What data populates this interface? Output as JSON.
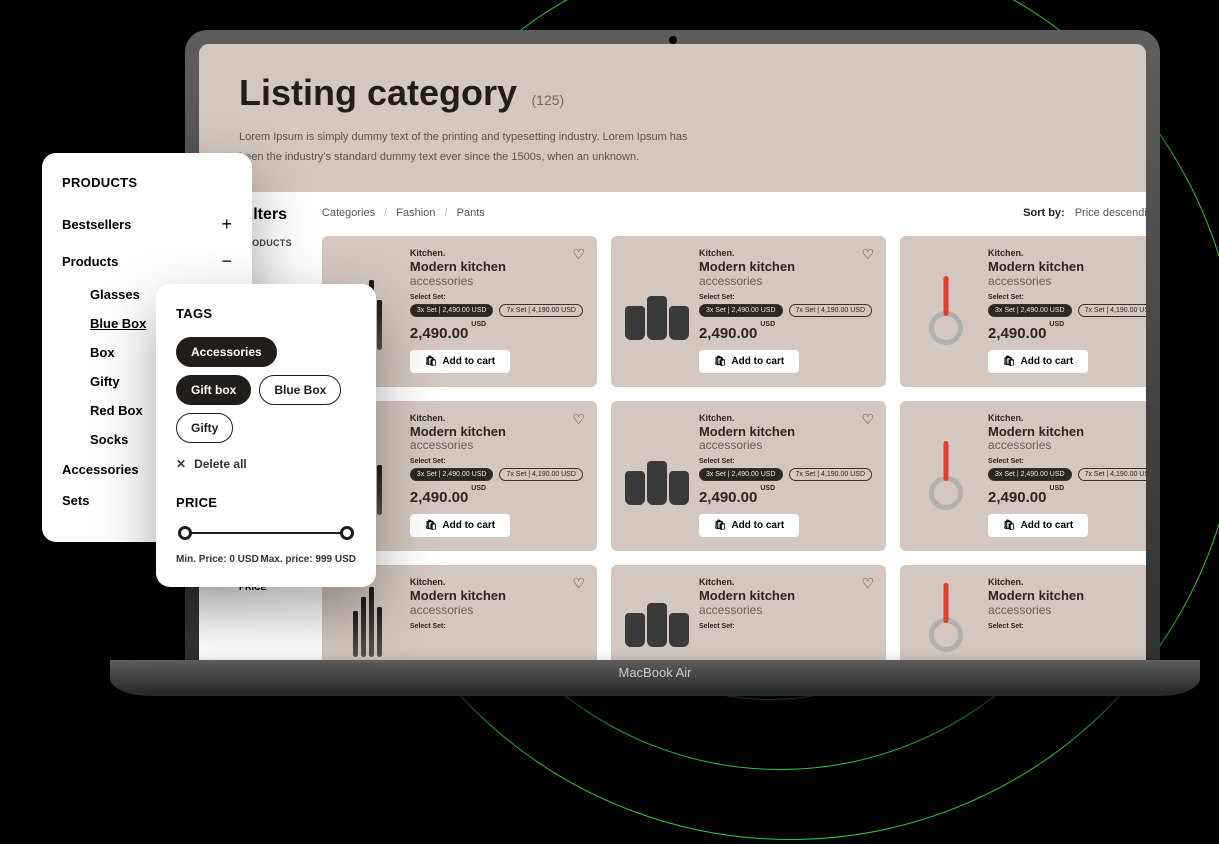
{
  "laptopModel": "MacBook Air",
  "hero": {
    "title": "Listing category",
    "count": "(125)",
    "description": "Lorem Ipsum is simply dummy text of the printing and typesetting industry. Lorem Ipsum has been the industry's standard dummy text ever since the 1500s, when an unknown."
  },
  "filtersColumn": {
    "title": "Filters",
    "productsLabel": "PRODUCTS",
    "deleteAllSmall": "× Delete all",
    "priceSmall": "PRICE"
  },
  "breadcrumb": {
    "l1": "Categories",
    "l2": "Fashion",
    "l3": "Pants"
  },
  "sort": {
    "label": "Sort by:",
    "value": "Price descending",
    "arrow": "↓"
  },
  "card": {
    "kicker": "Kitchen.",
    "title": "Modern kitchen",
    "subtitle": "accessories",
    "selectLabel": "Select Set:",
    "set1": "3x Set | 2,490.00 USD",
    "set2": "7x Set | 4,190.00 USD",
    "price": "2,490.00",
    "currency": "USD",
    "addLabel": "Add to cart"
  },
  "productsPanel": {
    "heading": "PRODUCTS",
    "bestsellers": "Bestsellers",
    "products": "Products",
    "subItems": {
      "glasses": "Glasses",
      "blueBox": "Blue Box",
      "box": "Box",
      "gifty": "Gifty",
      "redBox": "Red Box",
      "socks": "Socks"
    },
    "accessories": "Accessories",
    "sets": "Sets"
  },
  "tagsPanel": {
    "heading": "TAGS",
    "tags": {
      "accessories": "Accessories",
      "giftbox": "Gift box",
      "bluebox": "Blue Box",
      "gifty": "Gifty"
    },
    "deleteAll": "Delete all",
    "priceHeading": "PRICE",
    "minLabel": "Min. Price: 0 USD",
    "maxLabel": "Max. price: 999 USD"
  }
}
